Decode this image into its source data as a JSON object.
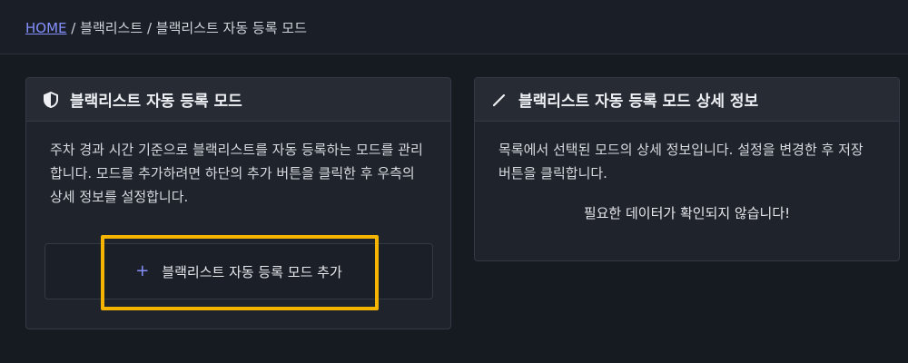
{
  "breadcrumb": {
    "home": "HOME",
    "sep1": "/",
    "level1": "블랙리스트",
    "sep2": "/",
    "level2": "블랙리스트 자동 등록 모드"
  },
  "left_card": {
    "icon": "shield-half-icon",
    "title": "블랙리스트 자동 등록 모드",
    "description": "주차 경과 시간 기준으로 블랙리스트를 자동 등록하는 모드를 관리합니다. 모드를 추가하려면 하단의 추가 버튼을 클릭한 후 우측의 상세 정보를 설정합니다.",
    "add_button_icon": "plus-icon",
    "add_button_label": "블랙리스트 자동 등록 모드 추가"
  },
  "right_card": {
    "icon": "pencil-icon",
    "title": "블랙리스트 자동 등록 모드 상세 정보",
    "description": "목록에서 선택된 모드의 상세 정보입니다. 설정을 변경한 후 저장 버튼을 클릭합니다.",
    "empty_notice": "필요한 데이터가 확인되지 않습니다!"
  },
  "colors": {
    "background": "#161a21",
    "card": "#1f242c",
    "accent": "#8590ff",
    "highlight": "#f5b400"
  }
}
